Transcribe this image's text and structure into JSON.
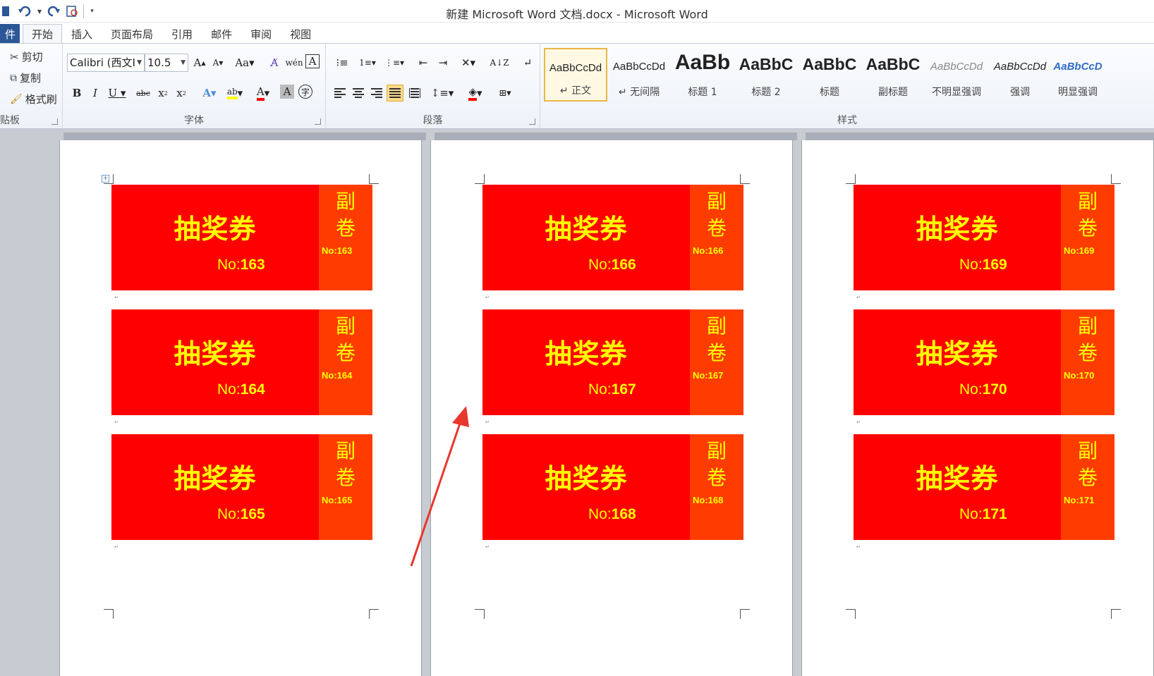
{
  "window": {
    "title": "新建 Microsoft Word 文档.docx - Microsoft Word"
  },
  "tabs": [
    {
      "label": "件",
      "id": "file"
    },
    {
      "label": "开始",
      "id": "home"
    },
    {
      "label": "插入",
      "id": "insert"
    },
    {
      "label": "页面布局",
      "id": "layout"
    },
    {
      "label": "引用",
      "id": "references"
    },
    {
      "label": "邮件",
      "id": "mailings"
    },
    {
      "label": "审阅",
      "id": "review"
    },
    {
      "label": "视图",
      "id": "view"
    }
  ],
  "ribbon": {
    "clipboard": {
      "label": "贴板",
      "cut": "剪切",
      "copy": "复制",
      "format_painter": "格式刷"
    },
    "font": {
      "label": "字体",
      "font_name": "Calibri (西文I",
      "font_size": "10.5"
    },
    "paragraph": {
      "label": "段落"
    },
    "styles": {
      "label": "样式",
      "items": [
        {
          "preview": "AaBbCcDd",
          "name": "↵ 正文"
        },
        {
          "preview": "AaBbCcDd",
          "name": "↵ 无间隔"
        },
        {
          "preview": "AaBb",
          "name": "标题 1"
        },
        {
          "preview": "AaBbC",
          "name": "标题 2"
        },
        {
          "preview": "AaBbC",
          "name": "标题"
        },
        {
          "preview": "AaBbC",
          "name": "副标题"
        },
        {
          "preview": "AaBbCcDd",
          "name": "不明显强调"
        },
        {
          "preview": "AaBbCcDd",
          "name": "强调"
        },
        {
          "preview": "AaBbCcD",
          "name": "明显强调"
        }
      ]
    }
  },
  "ticket_text": {
    "title": "抽奖券",
    "stub_char1": "副",
    "stub_char2": "卷",
    "no_prefix": "No:"
  },
  "pages": [
    {
      "tickets": [
        "163",
        "164",
        "165"
      ]
    },
    {
      "tickets": [
        "166",
        "167",
        "168"
      ]
    },
    {
      "tickets": [
        "169",
        "170",
        "171"
      ]
    }
  ],
  "colors": {
    "ticket_main": "#ff0000",
    "ticket_stub": "#ff3c00",
    "ticket_text": "#ffff00",
    "annotation_arrow": "#e8372c"
  }
}
